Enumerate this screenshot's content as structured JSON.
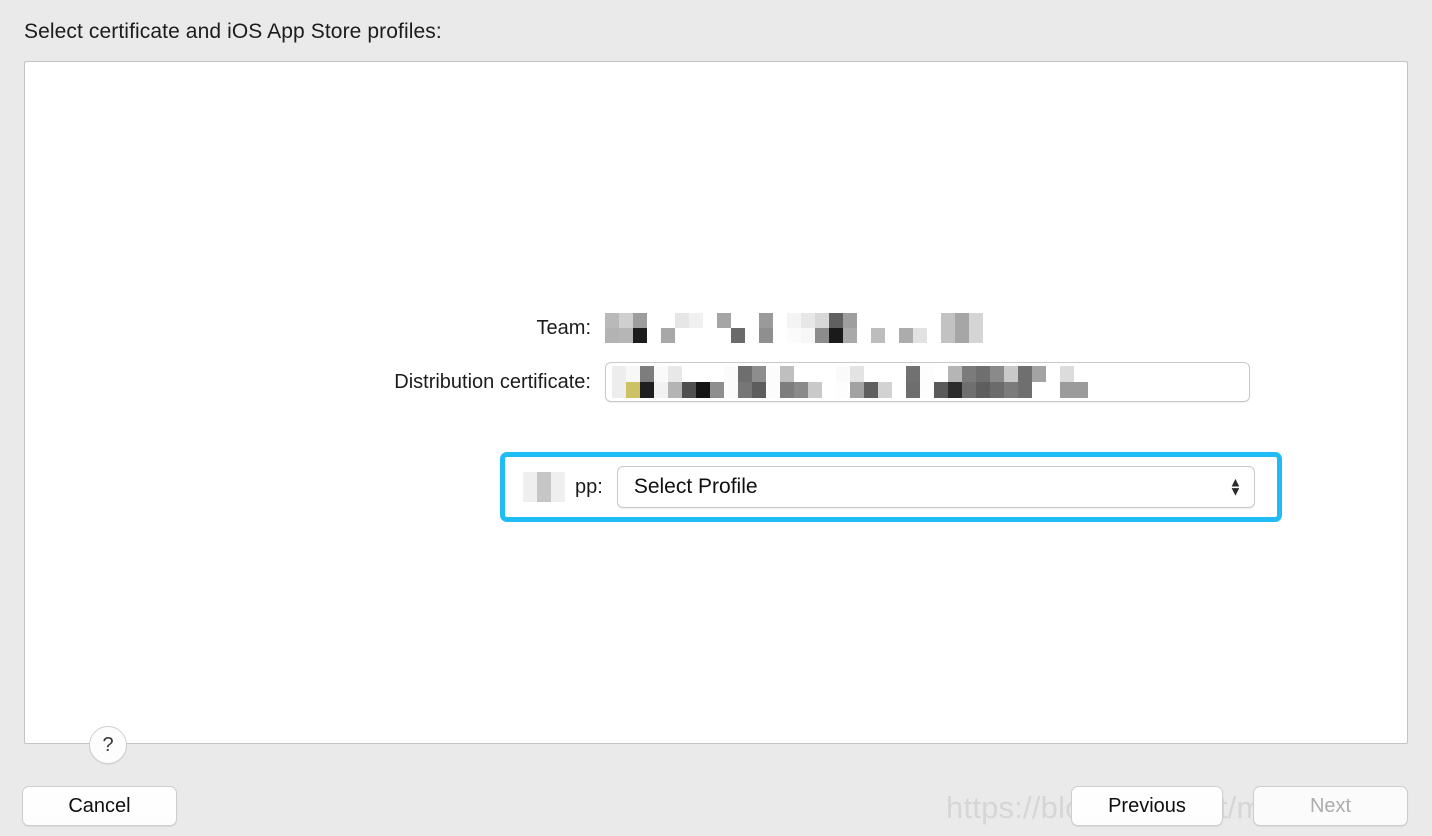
{
  "sheet": {
    "title": "Select certificate and iOS App Store profiles:"
  },
  "form": {
    "team": {
      "label": "Team:",
      "value_redacted": true,
      "redaction_note": "mosaic"
    },
    "certificate": {
      "label": "Distribution certificate:",
      "value_redacted": true,
      "redaction_note": "mosaic",
      "stepper_icon": "chevron-up-down-icon"
    },
    "profile": {
      "label_visible_fragment": "pp:",
      "label_redacted_prefix": true,
      "value": "Select Profile",
      "stepper_icon": "chevron-up-down-icon",
      "focused": true,
      "highlight_color": "#1fbcf5"
    }
  },
  "help": {
    "glyph": "?",
    "icon": "question-mark-icon"
  },
  "footer": {
    "cancel_label": "Cancel",
    "previous_label": "Previous",
    "next_label": "Next",
    "next_disabled": true
  },
  "watermark": {
    "text": "https://blog.csdn.net/m_rNext001"
  },
  "mosaic": {
    "team": [
      [
        "#b9b9b9",
        "#b3b3b3"
      ],
      [
        "#cfcfcf",
        "#b6b6b6"
      ],
      [
        "#9d9d9d",
        "#1d1d1d"
      ],
      [
        "#ffffff",
        "#ffffff"
      ],
      [
        "#ffffff",
        "#a8a8a8"
      ],
      [
        "#e6e6e6",
        "#ffffff"
      ],
      [
        "#f0f0f0",
        "#ffffff"
      ],
      [
        "#ffffff",
        "#ffffff"
      ],
      [
        "#a5a5a5",
        "#ffffff"
      ],
      [
        "#ffffff",
        "#6a6a6a"
      ],
      [
        "#ffffff",
        "#ffffff"
      ],
      [
        "#9a9a9a",
        "#8f8f8f"
      ],
      [
        "#ffffff",
        "#ffffff"
      ],
      [
        "#f4f4f4",
        "#fbfbfb"
      ],
      [
        "#e7e7e7",
        "#f7f7f7"
      ],
      [
        "#d8d8d8",
        "#8c8c8c"
      ],
      [
        "#606060",
        "#1a1a1a"
      ],
      [
        "#9e9e9e",
        "#a9a9a9"
      ],
      [
        "#ffffff",
        "#ffffff"
      ],
      [
        "#ffffff",
        "#bdbdbd"
      ],
      [
        "#ffffff",
        "#ffffff"
      ],
      [
        "#ffffff",
        "#acacac"
      ],
      [
        "#ffffff",
        "#e2e2e2"
      ],
      [
        "#ffffff",
        "#ffffff"
      ],
      [
        "#c2c2c2",
        "#c2c2c2"
      ],
      [
        "#a6a6a6",
        "#a6a6a6"
      ],
      [
        "#d5d5d5",
        "#d5d5d5"
      ]
    ],
    "certificate": [
      [
        "#ededed",
        "#ededed"
      ],
      [
        "#f7f7f7",
        "#cdc263"
      ],
      [
        "#7d7d7d",
        "#1f1f1f"
      ],
      [
        "#fafafa",
        "#f2f2f2"
      ],
      [
        "#e8e8e8",
        "#b4b4b4"
      ],
      [
        "#ffffff",
        "#4f4f4f"
      ],
      [
        "#ffffff",
        "#151515"
      ],
      [
        "#ffffff",
        "#8e8e8e"
      ],
      [
        "#fbfbfb",
        "#fbfbfb"
      ],
      [
        "#6e6e6e",
        "#767676"
      ],
      [
        "#8d8d8d",
        "#5d5d5d"
      ],
      [
        "#fcfcfc",
        "#fcfcfc"
      ],
      [
        "#bfbfbf",
        "#7d7d7d"
      ],
      [
        "#ffffff",
        "#8a8a8a"
      ],
      [
        "#ffffff",
        "#c9c9c9"
      ],
      [
        "#ffffff",
        "#ffffff"
      ],
      [
        "#fafafa",
        "#fdfdfd"
      ],
      [
        "#e3e3e3",
        "#a2a2a2"
      ],
      [
        "#ffffff",
        "#5f5f5f"
      ],
      [
        "#ffffff",
        "#d2d2d2"
      ],
      [
        "#ffffff",
        "#ffffff"
      ],
      [
        "#717171",
        "#6e6e6e"
      ],
      [
        "#fdfdfd",
        "#fdfdfd"
      ],
      [
        "#ffffff",
        "#5a5a5a"
      ],
      [
        "#b5b5b5",
        "#2c2c2c"
      ],
      [
        "#7b7b7b",
        "#6f6f6f"
      ],
      [
        "#6f6f6f",
        "#5e5e5e"
      ],
      [
        "#8a8a8a",
        "#6b6b6b"
      ],
      [
        "#c9c9c9",
        "#7b7b7b"
      ],
      [
        "#6f6f6f",
        "#6f6f6f"
      ],
      [
        "#a3a3a3",
        "#ffffff"
      ],
      [
        "#ffffff",
        "#ffffff"
      ],
      [
        "#dcdcdc",
        "#9b9b9b"
      ],
      [
        "#ffffff",
        "#9b9b9b"
      ],
      [
        "#ffffff",
        "#ffffff"
      ]
    ],
    "profile_label": [
      [
        "#efefef",
        "#efefef"
      ],
      [
        "#c6c6c6",
        "#c6c6c6"
      ],
      [
        "#efefef",
        "#efefef"
      ]
    ]
  }
}
